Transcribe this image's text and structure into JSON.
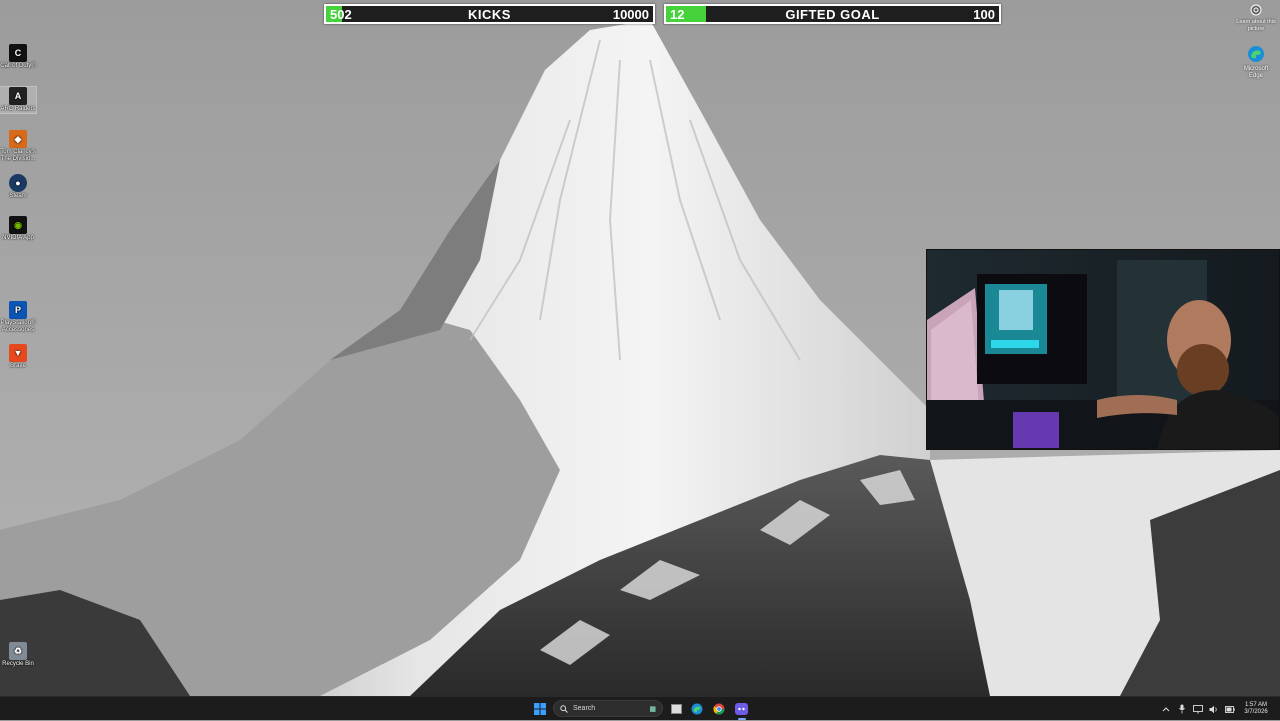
{
  "overlay": {
    "kicks": {
      "current": "502",
      "label": "KICKS",
      "target": "10000",
      "progress": 0.0502
    },
    "gifted": {
      "current": "12",
      "label": "GIFTED GOAL",
      "target": "100",
      "progress": 0.12
    }
  },
  "desktop_icons": [
    {
      "label": "Call of Duty®"
    },
    {
      "label": "ARC Raiders"
    },
    {
      "label": "Tom Clancy's The Divisio..."
    },
    {
      "label": "Steam"
    },
    {
      "label": "NVIDIA App"
    },
    {
      "label": "PlayStation® Accessories"
    },
    {
      "label": "Brave"
    },
    {
      "label": "Recycle Bin"
    }
  ],
  "right_icons": {
    "learn": "Learn about this picture",
    "edge": "Microsoft Edge"
  },
  "taskbar": {
    "search_placeholder": "Search",
    "time": "1:57 AM",
    "date": "3/7/2026"
  },
  "colors": {
    "goal_fill": "#46d23a",
    "taskbar_bg": "#1c1c1c"
  }
}
